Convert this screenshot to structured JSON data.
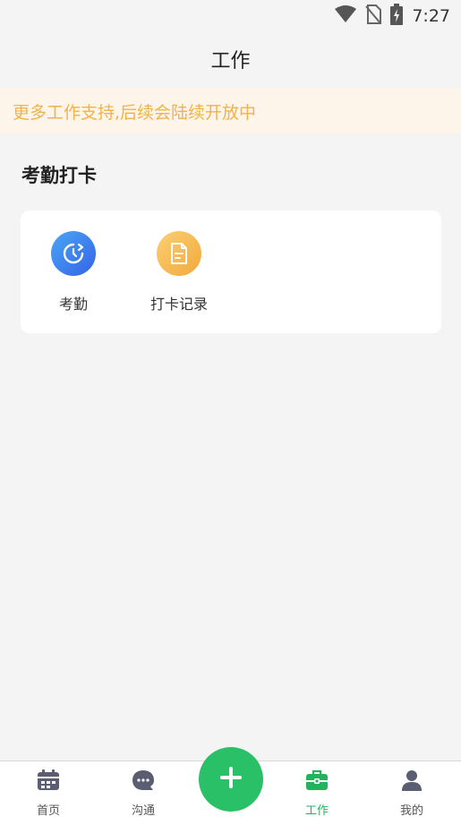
{
  "status_bar": {
    "time": "7:27",
    "icons": [
      "wifi-icon",
      "no-sim-icon",
      "battery-charging-icon"
    ]
  },
  "header": {
    "title": "工作"
  },
  "notice": {
    "text": "更多工作支持,后续会陆续开放中"
  },
  "section": {
    "title": "考勤打卡",
    "items": [
      {
        "label": "考勤",
        "icon": "clock-icon",
        "color": "#3b82f6"
      },
      {
        "label": "打卡记录",
        "icon": "document-icon",
        "color": "#f6b84a"
      }
    ]
  },
  "tabbar": {
    "tabs": [
      {
        "label": "首页",
        "icon": "calendar-icon",
        "active": false
      },
      {
        "label": "沟通",
        "icon": "chat-icon",
        "active": false
      },
      {
        "label": "工作",
        "icon": "briefcase-icon",
        "active": true
      },
      {
        "label": "我的",
        "icon": "person-icon",
        "active": false
      }
    ],
    "fab_icon": "plus-icon",
    "accent_color": "#29c068"
  }
}
